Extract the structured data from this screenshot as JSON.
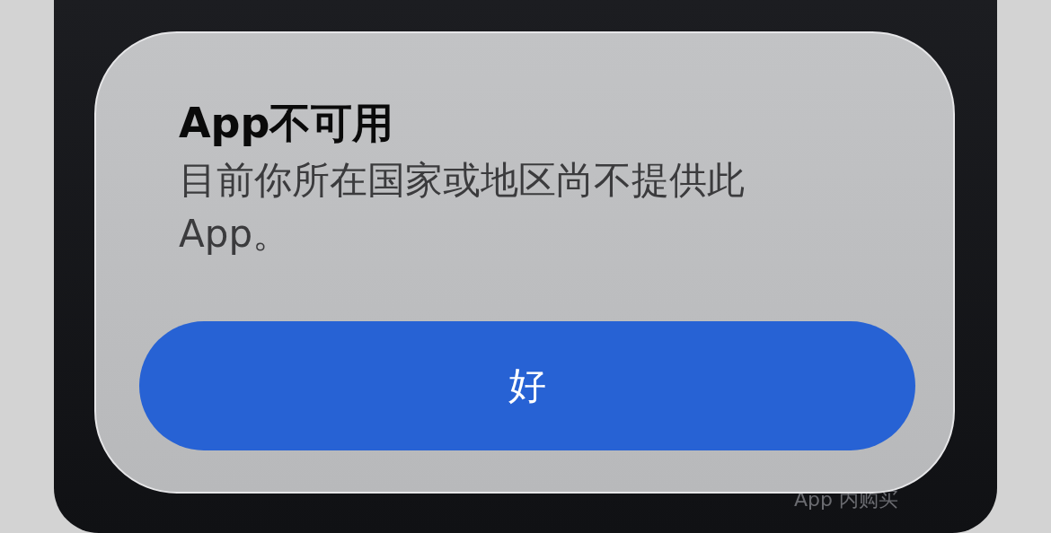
{
  "dialog": {
    "title": "App不可用",
    "message": "目前你所在国家或地区尚不提供此App。",
    "button": "好"
  },
  "background": {
    "label": "App 内购买"
  }
}
